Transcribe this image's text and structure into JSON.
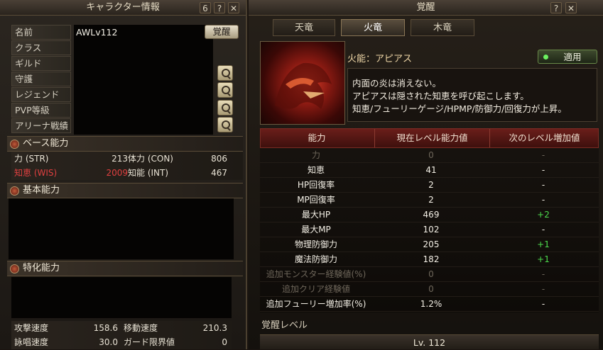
{
  "left": {
    "title": "キャラクター情報",
    "title_icons": [
      "6",
      "?",
      "✕"
    ],
    "info_labels": [
      "名前",
      "クラス",
      "ギルド",
      "守護",
      "レジェンド",
      "PVP等級",
      "アリーナ戦績"
    ],
    "name_value": "AWLv112",
    "awaken_button": "覚醒",
    "base_section": "ベース能力",
    "base_stats": {
      "str_label": "力 (STR)",
      "str_value": "213",
      "con_label": "体力 (CON)",
      "con_value": "806",
      "wis_label": "知恵 (WIS)",
      "wis_value": "2009",
      "int_label": "知能 (INT)",
      "int_value": "467"
    },
    "basic_section": "基本能力",
    "special_section": "特化能力",
    "bottom_stats": {
      "atk_speed_label": "攻撃速度",
      "atk_speed_value": "158.6",
      "move_speed_label": "移動速度",
      "move_speed_value": "210.3",
      "cast_speed_label": "詠唱速度",
      "cast_speed_value": "30.0",
      "guard_label": "ガード限界値",
      "guard_value": "0"
    }
  },
  "right": {
    "title": "覚醒",
    "title_icons": [
      "?",
      "✕"
    ],
    "tabs": [
      "天竜",
      "火竜",
      "木竜"
    ],
    "active_tab": 1,
    "ability_name": "火能：アピアス",
    "apply_button": "適用",
    "description": [
      "内面の炎は消えない。",
      "アピアスは隠された知恵を呼び起こします。",
      "知恵/フューリーゲージ/HPMP/防御力/回復力が上昇。"
    ],
    "table_headers": [
      "能力",
      "現在レベル能力値",
      "次のレベル増加値"
    ],
    "rows": [
      {
        "name": "力",
        "current": "0",
        "next": "-",
        "dim": true
      },
      {
        "name": "知恵",
        "current": "41",
        "next": "-"
      },
      {
        "name": "HP回復率",
        "current": "2",
        "next": "-"
      },
      {
        "name": "MP回復率",
        "current": "2",
        "next": "-"
      },
      {
        "name": "最大HP",
        "current": "469",
        "next": "+2",
        "green": true
      },
      {
        "name": "最大MP",
        "current": "102",
        "next": "-"
      },
      {
        "name": "物理防御力",
        "current": "205",
        "next": "+1",
        "green": true
      },
      {
        "name": "魔法防御力",
        "current": "182",
        "next": "+1",
        "green": true
      },
      {
        "name": "追加モンスター経験値(%)",
        "current": "0",
        "next": "-",
        "dim": true
      },
      {
        "name": "追加クリア経験値",
        "current": "0",
        "next": "-",
        "dim": true
      },
      {
        "name": "追加フューリー増加率(%)",
        "current": "1.2%",
        "next": "-"
      }
    ],
    "awaken_level_label": "覚醒レベル",
    "awaken_level_value": "Lv. 112"
  },
  "colors": {
    "accent_red": "#e04040",
    "green": "#4cd84c",
    "table_header": "#6a1e1a"
  }
}
